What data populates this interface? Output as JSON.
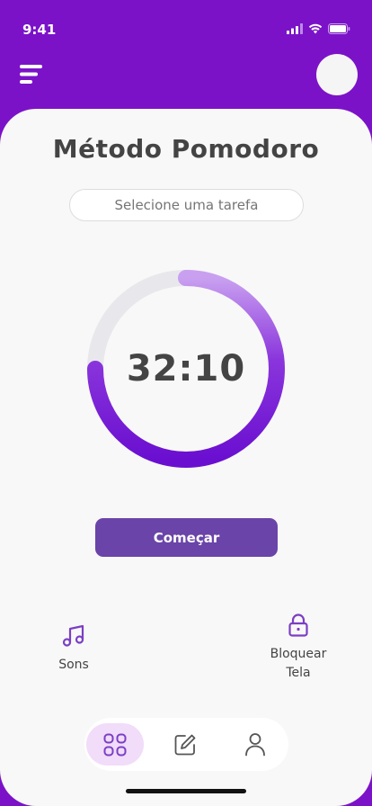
{
  "status_bar": {
    "time": "9:41"
  },
  "header": {
    "menu_icon": "hamburger-icon",
    "avatar_icon": "avatar-circle"
  },
  "main": {
    "title": "Método Pomodoro",
    "task_placeholder": "Selecione uma tarefa",
    "timer_value": "32:10",
    "timer_progress_fraction": 0.75,
    "start_label": "Começar"
  },
  "actions": {
    "sounds_label": "Sons",
    "lock_label_line1": "Bloquear",
    "lock_label_line2": "Tela"
  },
  "bottom_nav": {
    "items": [
      {
        "icon": "grid-icon",
        "active": true
      },
      {
        "icon": "edit-icon",
        "active": false
      },
      {
        "icon": "profile-icon",
        "active": false
      }
    ]
  },
  "colors": {
    "header_purple": "#7b12c8",
    "button_purple": "#6a44a8",
    "ring_start": "#c9a0f0",
    "ring_end": "#6a0fd0",
    "track_gray": "#e8e8ec",
    "nav_active_bg": "#f1dcf9"
  }
}
